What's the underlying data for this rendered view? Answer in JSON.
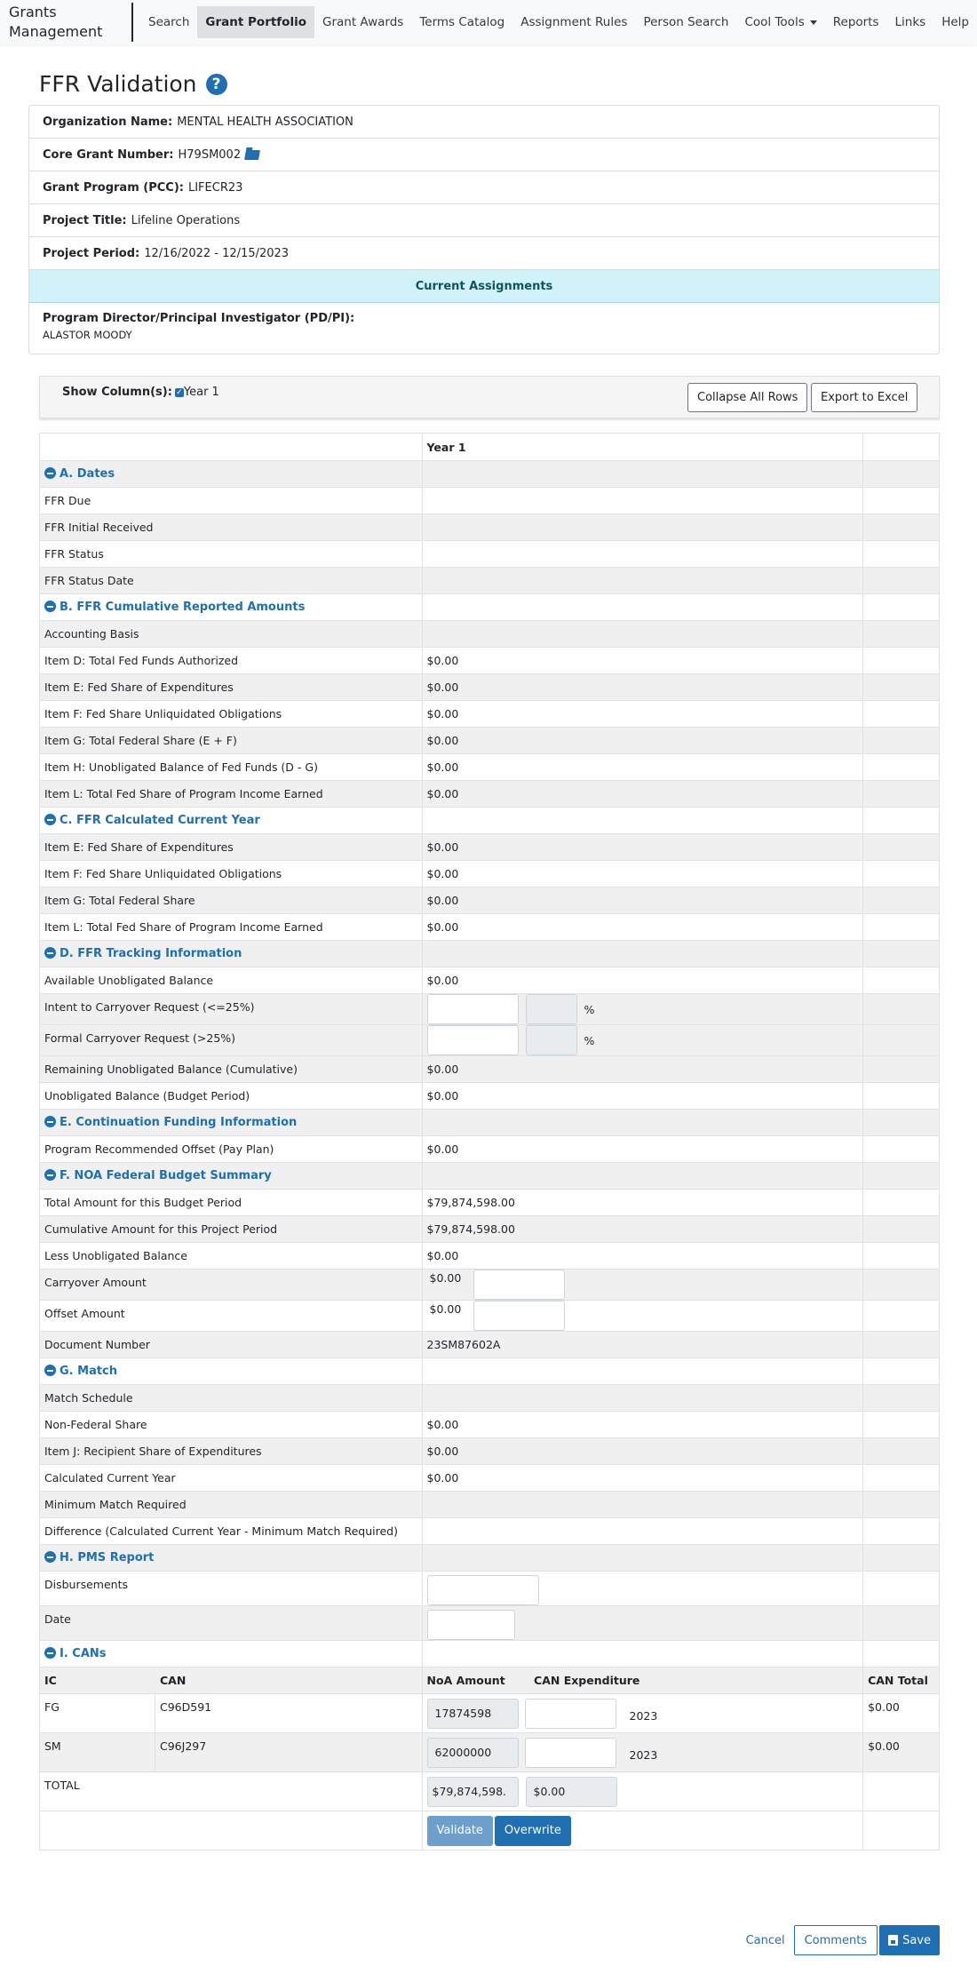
{
  "nav": {
    "brand": "Grants Management",
    "items": [
      {
        "label": "Search",
        "active": false
      },
      {
        "label": "Grant Portfolio",
        "active": true
      },
      {
        "label": "Grant Awards",
        "active": false
      },
      {
        "label": "Terms Catalog",
        "active": false
      },
      {
        "label": "Assignment Rules",
        "active": false
      },
      {
        "label": "Person Search",
        "active": false
      },
      {
        "label": "Cool Tools",
        "active": false,
        "dropdown": true
      },
      {
        "label": "Reports",
        "active": false
      },
      {
        "label": "Links",
        "active": false
      },
      {
        "label": "Help",
        "active": false
      }
    ]
  },
  "page": {
    "title": "FFR Validation",
    "help_icon": "question-circle-icon"
  },
  "info": {
    "org_label": "Organization Name:",
    "org_value": "MENTAL HEALTH ASSOCIATION",
    "grant_label": "Core Grant Number:",
    "grant_value": "H79SM002",
    "grant_icon": "folder-open-icon",
    "program_label": "Grant Program (PCC):",
    "program_value": "LIFECR23",
    "title_label": "Project Title:",
    "title_value": "Lifeline Operations",
    "period_label": "Project Period:",
    "period_value": "12/16/2022 - 12/15/2023",
    "assignments_header": "Current Assignments",
    "pi_label": "Program Director/Principal Investigator (PD/PI):",
    "pi_name": "ALASTOR MOODY"
  },
  "toolbar": {
    "show_columns_label": "Show Column(s):",
    "column_option": "Year 1",
    "column_checked": true,
    "collapse_label": "Collapse All Rows",
    "export_label": "Export to Excel"
  },
  "table": {
    "year_header": "Year 1",
    "sections": {
      "a": {
        "title": "A. Dates",
        "rows": [
          {
            "label": "FFR Due",
            "value": ""
          },
          {
            "label": "FFR Initial Received",
            "value": ""
          },
          {
            "label": "FFR Status",
            "value": ""
          },
          {
            "label": "FFR Status Date",
            "value": ""
          }
        ]
      },
      "b": {
        "title": "B. FFR Cumulative Reported Amounts",
        "rows": [
          {
            "label": "Accounting Basis",
            "value": ""
          },
          {
            "label": "Item D: Total Fed Funds Authorized",
            "value": "$0.00"
          },
          {
            "label": "Item E: Fed Share of Expenditures",
            "value": "$0.00"
          },
          {
            "label": "Item F: Fed Share Unliquidated Obligations",
            "value": "$0.00"
          },
          {
            "label": "Item G: Total Federal Share (E + F)",
            "value": "$0.00"
          },
          {
            "label": "Item H: Unobligated Balance of Fed Funds (D - G)",
            "value": "$0.00"
          },
          {
            "label": "Item L: Total Fed Share of Program Income Earned",
            "value": "$0.00"
          }
        ]
      },
      "c": {
        "title": "C. FFR Calculated Current Year",
        "rows": [
          {
            "label": "Item E: Fed Share of Expenditures",
            "value": "$0.00"
          },
          {
            "label": "Item F: Fed Share Unliquidated Obligations",
            "value": "$0.00"
          },
          {
            "label": "Item G: Total Federal Share",
            "value": "$0.00"
          },
          {
            "label": "Item L: Total Fed Share of Program Income Earned",
            "value": "$0.00"
          }
        ]
      },
      "d": {
        "title": "D. FFR Tracking Information",
        "rows": [
          {
            "label": "Available Unobligated Balance",
            "value": "$0.00"
          },
          {
            "label": "Intent to Carryover Request (<=25%)",
            "input_value": "",
            "pct_value": "",
            "pct_symbol": "%"
          },
          {
            "label": "Formal Carryover Request (>25%)",
            "input_value": "",
            "pct_value": "",
            "pct_symbol": "%"
          },
          {
            "label": "Remaining Unobligated Balance (Cumulative)",
            "value": "$0.00"
          },
          {
            "label": "Unobligated Balance (Budget Period)",
            "value": "$0.00"
          }
        ]
      },
      "e": {
        "title": "E. Continuation Funding Information",
        "rows": [
          {
            "label": "Program Recommended Offset (Pay Plan)",
            "value": "$0.00"
          }
        ]
      },
      "f": {
        "title": "F. NOA Federal Budget Summary",
        "rows": [
          {
            "label": "Total Amount for this Budget Period",
            "value": "$79,874,598.00"
          },
          {
            "label": "Cumulative Amount for this Project Period",
            "value": "$79,874,598.00"
          },
          {
            "label": "Less Unobligated Balance",
            "value": "$0.00"
          },
          {
            "label": "Carryover Amount",
            "value": "$0.00",
            "input_value": ""
          },
          {
            "label": "Offset Amount",
            "value": "$0.00",
            "input_value": ""
          },
          {
            "label": "Document Number",
            "value": "23SM87602A"
          }
        ]
      },
      "g": {
        "title": "G. Match",
        "rows": [
          {
            "label": "Match Schedule",
            "value": ""
          },
          {
            "label": "Non-Federal Share",
            "value": "$0.00"
          },
          {
            "label": "Item J: Recipient Share of Expenditures",
            "value": "$0.00"
          },
          {
            "label": "Calculated Current Year",
            "value": "$0.00"
          },
          {
            "label": "Minimum Match Required",
            "value": ""
          },
          {
            "label": "Difference (Calculated Current Year - Minimum Match Required)",
            "value": ""
          }
        ]
      },
      "h": {
        "title": "H. PMS Report",
        "rows": [
          {
            "label": "Disbursements",
            "input_value": ""
          },
          {
            "label": "Date",
            "input_value": ""
          }
        ]
      },
      "i": {
        "title": "I. CANs",
        "headers": {
          "ic": "IC",
          "can": "CAN",
          "noa": "NoA Amount",
          "expenditure": "CAN Expenditure",
          "total": "CAN Total"
        },
        "rows": [
          {
            "ic": "FG",
            "can": "C96D591",
            "noa": "17874598",
            "expenditure": "",
            "year": "2023",
            "total": "$0.00"
          },
          {
            "ic": "SM",
            "can": "C96J297",
            "noa": "62000000",
            "expenditure": "",
            "year": "2023",
            "total": "$0.00"
          }
        ],
        "total_label": "TOTAL",
        "total_noa": "$79,874,598.",
        "total_expenditure": "$0.00",
        "validate_label": "Validate",
        "overwrite_label": "Overwrite"
      }
    }
  },
  "footer": {
    "cancel_label": "Cancel",
    "comments_label": "Comments",
    "save_label": "Save"
  },
  "colors": {
    "primary": "#1f6fb2",
    "assign_bg": "#d1f2f9",
    "assign_text": "#0c5460",
    "validate_disabled": "#6c9fcc"
  }
}
